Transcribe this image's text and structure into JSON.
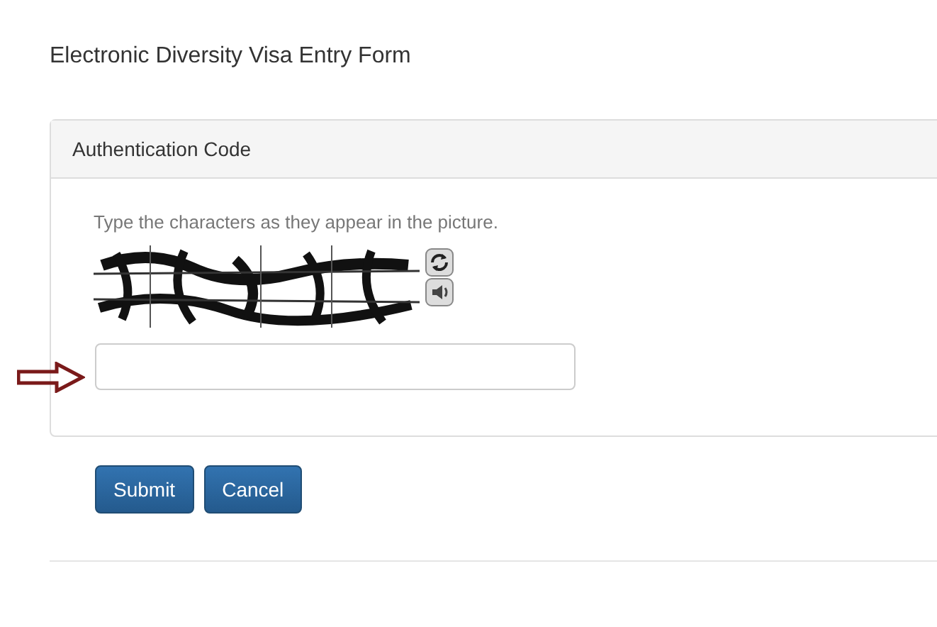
{
  "page_title": "Electronic Diversity Visa Entry Form",
  "panel": {
    "heading": "Authentication Code",
    "instruction": "Type the characters as they appear in the picture."
  },
  "buttons": [
    {
      "label": "Submit"
    },
    {
      "label": "Cancel"
    }
  ]
}
